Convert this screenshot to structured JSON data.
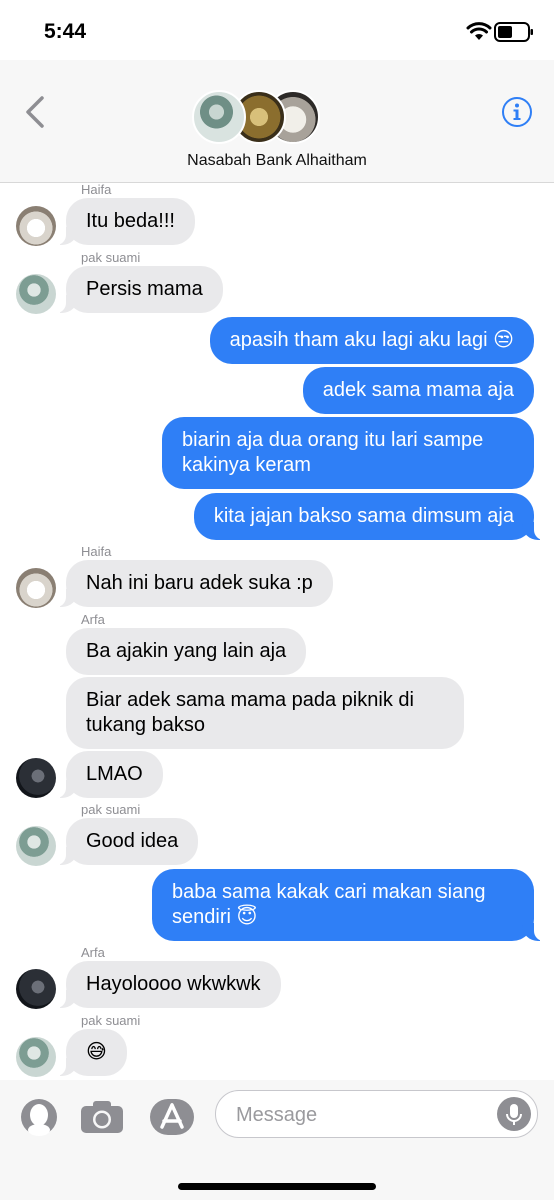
{
  "status_bar": {
    "time": "5:44"
  },
  "header": {
    "group_name": "Nasabah Bank Alhaitham"
  },
  "messages": [
    {
      "sender": "Haifa",
      "text": "Itu beda!!!"
    },
    {
      "sender": "pak suami",
      "text": "Persis mama"
    },
    {
      "text": "apasih tham aku lagi aku lagi 😒"
    },
    {
      "text": "adek sama mama aja"
    },
    {
      "text": "biarin aja dua orang itu lari sampe kakinya keram"
    },
    {
      "text": "kita jajan bakso sama dimsum aja"
    },
    {
      "sender": "Haifa",
      "text": "Nah ini baru adek suka :p"
    },
    {
      "sender": "Arfa",
      "text": "Ba ajakin yang lain aja"
    },
    {
      "text": "Biar adek sama mama pada piknik di tukang bakso"
    },
    {
      "text": "LMAO"
    },
    {
      "sender": "pak suami",
      "text": "Good idea"
    },
    {
      "text": "baba sama kakak cari makan siang sendiri 😇"
    },
    {
      "sender": "Arfa",
      "text": "Hayoloooo wkwkwk"
    },
    {
      "sender": "pak suami",
      "text": "😅"
    }
  ],
  "composer": {
    "placeholder": "Message"
  },
  "colors": {
    "outgoing": "#2f7ff6",
    "incoming": "#e9e9eb",
    "accent": "#2f7ff6"
  },
  "icons": [
    "back-chevron-icon",
    "info-icon",
    "memoji-icon",
    "camera-icon",
    "app-store-icon",
    "microphone-icon",
    "wifi-icon",
    "battery-icon"
  ]
}
